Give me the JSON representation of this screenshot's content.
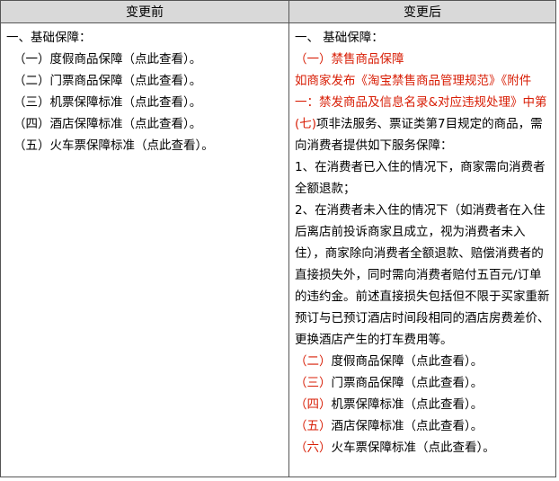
{
  "header": {
    "before": "变更前",
    "after": "变更后"
  },
  "before": {
    "title": "一、基础保障：",
    "items": [
      "（一）度假商品保障（点此查看）。",
      "（二）门票商品保障（点此查看）。",
      "（三）机票保障标准（点此查看）。",
      "（四）酒店保障标准（点此查看）。",
      "（五）火车票保障标准（点此查看）。"
    ]
  },
  "after": {
    "title": "一、  基础保障：",
    "section1_title": "（一）禁售商品保障",
    "section1_red_intro": "如商家发布《淘宝禁售商品管理规范》《附件一：禁发商品及信息名录&对应违规处理》中第(七)",
    "section1_black_intro": "项非法服务、票证类第7目规定的商品，需向消费者提供如下服务保障：",
    "clause1": "1、在消费者已入住的情况下，商家需向消费者全额退款；",
    "clause2": "2、在消费者未入住的情况下（如消费者在入住后离店前投诉商家且成立，视为消费者未入住），商家除向消费者全额退款、赔偿消费者的直接损失外，同时需向消费者赔付五百元/订单的违约金。前述直接损失包括但不限于买家重新预订与已预订酒店时间段相同的酒店房费差价、更换酒店产生的打车费用等。",
    "items": [
      {
        "num": "（二）",
        "text": "度假商品保障（点此查看）。"
      },
      {
        "num": "（三）",
        "text": "门票商品保障（点此查看）。"
      },
      {
        "num": "（四）",
        "text": "机票保障标准（点此查看）。"
      },
      {
        "num": "（五）",
        "text": "酒店保障标准（点此查看）。"
      },
      {
        "num": "（六）",
        "text": "火车票保障标准（点此查看）。"
      }
    ]
  },
  "colors": {
    "header_bg": "#d9d9d9",
    "border": "#555555",
    "red_text": "#d81e06",
    "text": "#000000"
  }
}
